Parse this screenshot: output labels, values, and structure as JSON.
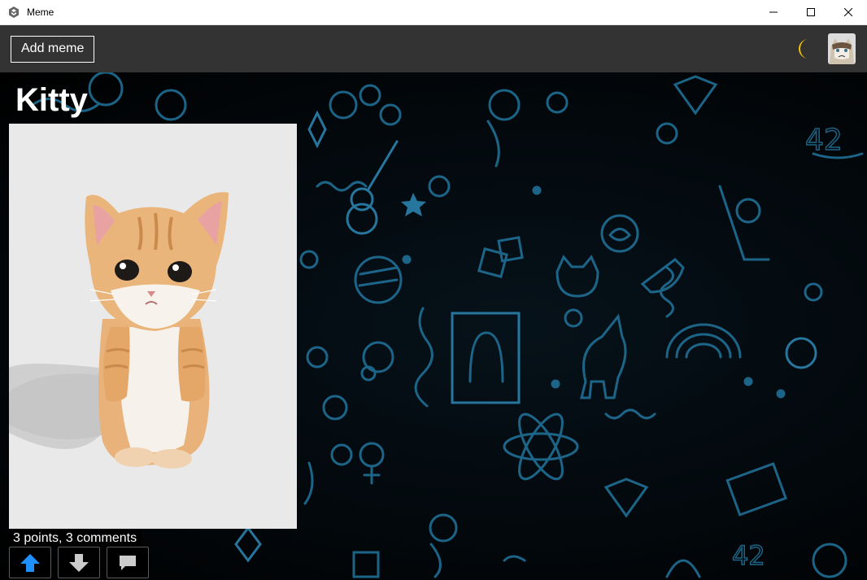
{
  "window": {
    "title": "Meme",
    "icon": "app-logo-icon",
    "controls": [
      "minimize-icon",
      "maximize-icon",
      "close-icon"
    ]
  },
  "header": {
    "add_button_label": "Add meme",
    "theme_toggle_icon": "moon-icon",
    "avatar": "grumpy-cat-avatar",
    "colors": {
      "bar": "#333333",
      "moon": "#f6c400"
    }
  },
  "meme": {
    "title": "Kitty",
    "image": "orange-kitten-standing",
    "stats": "3 points, 3 comments",
    "actions": [
      {
        "name": "upvote",
        "icon": "arrow-up-icon",
        "active": true,
        "color": "#1e90ff"
      },
      {
        "name": "downvote",
        "icon": "arrow-down-icon",
        "active": false,
        "color": "#cccccc"
      },
      {
        "name": "comments",
        "icon": "comment-icon",
        "active": false,
        "color": "#cccccc"
      }
    ]
  }
}
